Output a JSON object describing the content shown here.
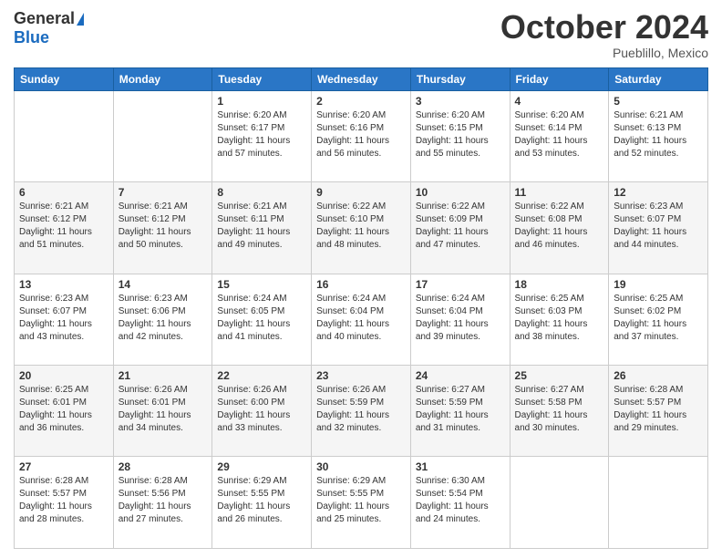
{
  "logo": {
    "general": "General",
    "blue": "Blue"
  },
  "header": {
    "month": "October 2024",
    "location": "Pueblillo, Mexico"
  },
  "days_of_week": [
    "Sunday",
    "Monday",
    "Tuesday",
    "Wednesday",
    "Thursday",
    "Friday",
    "Saturday"
  ],
  "weeks": [
    [
      {
        "day": "",
        "info": ""
      },
      {
        "day": "",
        "info": ""
      },
      {
        "day": "1",
        "info": "Sunrise: 6:20 AM\nSunset: 6:17 PM\nDaylight: 11 hours and 57 minutes."
      },
      {
        "day": "2",
        "info": "Sunrise: 6:20 AM\nSunset: 6:16 PM\nDaylight: 11 hours and 56 minutes."
      },
      {
        "day": "3",
        "info": "Sunrise: 6:20 AM\nSunset: 6:15 PM\nDaylight: 11 hours and 55 minutes."
      },
      {
        "day": "4",
        "info": "Sunrise: 6:20 AM\nSunset: 6:14 PM\nDaylight: 11 hours and 53 minutes."
      },
      {
        "day": "5",
        "info": "Sunrise: 6:21 AM\nSunset: 6:13 PM\nDaylight: 11 hours and 52 minutes."
      }
    ],
    [
      {
        "day": "6",
        "info": "Sunrise: 6:21 AM\nSunset: 6:12 PM\nDaylight: 11 hours and 51 minutes."
      },
      {
        "day": "7",
        "info": "Sunrise: 6:21 AM\nSunset: 6:12 PM\nDaylight: 11 hours and 50 minutes."
      },
      {
        "day": "8",
        "info": "Sunrise: 6:21 AM\nSunset: 6:11 PM\nDaylight: 11 hours and 49 minutes."
      },
      {
        "day": "9",
        "info": "Sunrise: 6:22 AM\nSunset: 6:10 PM\nDaylight: 11 hours and 48 minutes."
      },
      {
        "day": "10",
        "info": "Sunrise: 6:22 AM\nSunset: 6:09 PM\nDaylight: 11 hours and 47 minutes."
      },
      {
        "day": "11",
        "info": "Sunrise: 6:22 AM\nSunset: 6:08 PM\nDaylight: 11 hours and 46 minutes."
      },
      {
        "day": "12",
        "info": "Sunrise: 6:23 AM\nSunset: 6:07 PM\nDaylight: 11 hours and 44 minutes."
      }
    ],
    [
      {
        "day": "13",
        "info": "Sunrise: 6:23 AM\nSunset: 6:07 PM\nDaylight: 11 hours and 43 minutes."
      },
      {
        "day": "14",
        "info": "Sunrise: 6:23 AM\nSunset: 6:06 PM\nDaylight: 11 hours and 42 minutes."
      },
      {
        "day": "15",
        "info": "Sunrise: 6:24 AM\nSunset: 6:05 PM\nDaylight: 11 hours and 41 minutes."
      },
      {
        "day": "16",
        "info": "Sunrise: 6:24 AM\nSunset: 6:04 PM\nDaylight: 11 hours and 40 minutes."
      },
      {
        "day": "17",
        "info": "Sunrise: 6:24 AM\nSunset: 6:04 PM\nDaylight: 11 hours and 39 minutes."
      },
      {
        "day": "18",
        "info": "Sunrise: 6:25 AM\nSunset: 6:03 PM\nDaylight: 11 hours and 38 minutes."
      },
      {
        "day": "19",
        "info": "Sunrise: 6:25 AM\nSunset: 6:02 PM\nDaylight: 11 hours and 37 minutes."
      }
    ],
    [
      {
        "day": "20",
        "info": "Sunrise: 6:25 AM\nSunset: 6:01 PM\nDaylight: 11 hours and 36 minutes."
      },
      {
        "day": "21",
        "info": "Sunrise: 6:26 AM\nSunset: 6:01 PM\nDaylight: 11 hours and 34 minutes."
      },
      {
        "day": "22",
        "info": "Sunrise: 6:26 AM\nSunset: 6:00 PM\nDaylight: 11 hours and 33 minutes."
      },
      {
        "day": "23",
        "info": "Sunrise: 6:26 AM\nSunset: 5:59 PM\nDaylight: 11 hours and 32 minutes."
      },
      {
        "day": "24",
        "info": "Sunrise: 6:27 AM\nSunset: 5:59 PM\nDaylight: 11 hours and 31 minutes."
      },
      {
        "day": "25",
        "info": "Sunrise: 6:27 AM\nSunset: 5:58 PM\nDaylight: 11 hours and 30 minutes."
      },
      {
        "day": "26",
        "info": "Sunrise: 6:28 AM\nSunset: 5:57 PM\nDaylight: 11 hours and 29 minutes."
      }
    ],
    [
      {
        "day": "27",
        "info": "Sunrise: 6:28 AM\nSunset: 5:57 PM\nDaylight: 11 hours and 28 minutes."
      },
      {
        "day": "28",
        "info": "Sunrise: 6:28 AM\nSunset: 5:56 PM\nDaylight: 11 hours and 27 minutes."
      },
      {
        "day": "29",
        "info": "Sunrise: 6:29 AM\nSunset: 5:55 PM\nDaylight: 11 hours and 26 minutes."
      },
      {
        "day": "30",
        "info": "Sunrise: 6:29 AM\nSunset: 5:55 PM\nDaylight: 11 hours and 25 minutes."
      },
      {
        "day": "31",
        "info": "Sunrise: 6:30 AM\nSunset: 5:54 PM\nDaylight: 11 hours and 24 minutes."
      },
      {
        "day": "",
        "info": ""
      },
      {
        "day": "",
        "info": ""
      }
    ]
  ]
}
